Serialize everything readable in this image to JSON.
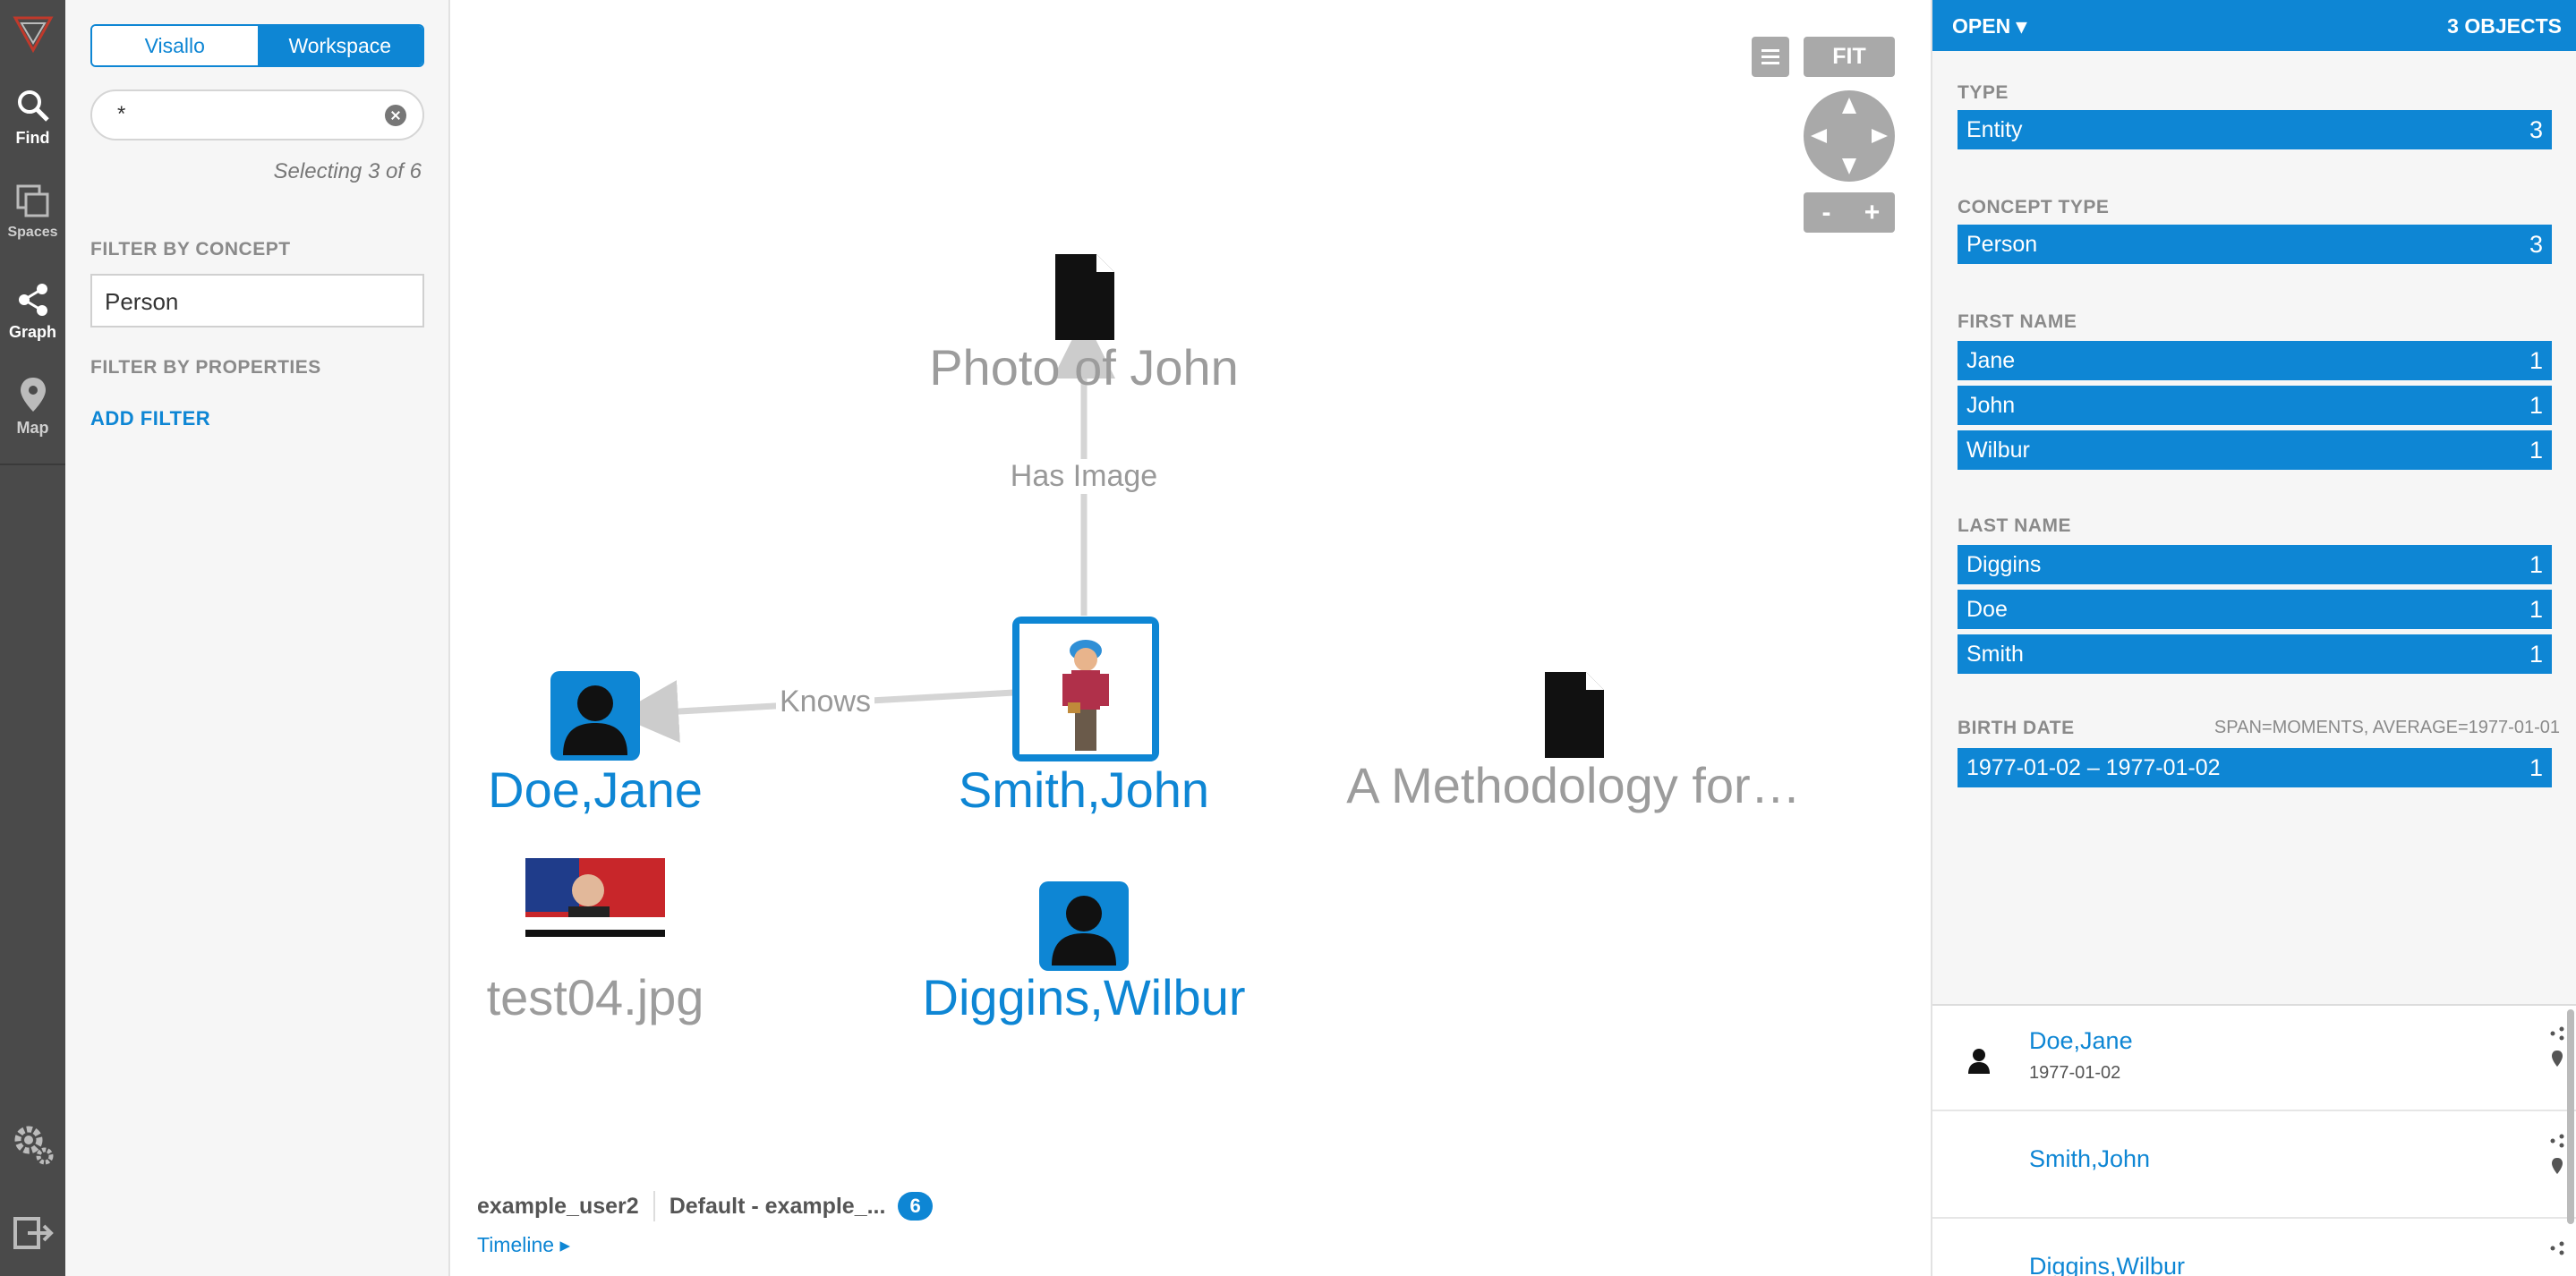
{
  "app": {
    "nav": [
      {
        "label": "Find",
        "icon": "search-icon"
      },
      {
        "label": "Spaces",
        "icon": "spaces-icon"
      },
      {
        "label": "Graph",
        "icon": "share-graph-icon"
      },
      {
        "label": "Map",
        "icon": "map-pin-icon"
      }
    ],
    "nav_bottom": [
      "settings-icon",
      "logout-icon"
    ]
  },
  "search": {
    "tabs": [
      "Visallo",
      "Workspace"
    ],
    "active_tab": "Workspace",
    "query": "*",
    "selecting": "Selecting 3 of 6",
    "filter_concept_title": "FILTER BY CONCEPT",
    "concept_value": "Person",
    "filter_props_title": "FILTER BY PROPERTIES",
    "add_filter": "ADD FILTER"
  },
  "graph": {
    "nodes": {
      "photo": "Photo of John",
      "doe": "Doe,Jane",
      "smith": "Smith,John",
      "methodology": "A Methodology for…",
      "test04": "test04.jpg",
      "diggins": "Diggins,Wilbur"
    },
    "edges": {
      "has_image": "Has Image",
      "knows": "Knows"
    },
    "controls": {
      "fit": "FIT",
      "zoom_out": "-",
      "zoom_in": "+"
    },
    "footer": {
      "user": "example_user2",
      "workspace": "Default - example_...",
      "count": "6",
      "timeline": "Timeline ▸"
    }
  },
  "details": {
    "open_label": "OPEN ▾",
    "count_label": "3 OBJECTS",
    "histograms": {
      "type": {
        "title": "TYPE",
        "bars": [
          {
            "value": "Entity",
            "count": "3"
          }
        ]
      },
      "concept": {
        "title": "CONCEPT TYPE",
        "bars": [
          {
            "value": "Person",
            "count": "3"
          }
        ]
      },
      "first": {
        "title": "FIRST NAME",
        "bars": [
          {
            "value": "Jane",
            "count": "1"
          },
          {
            "value": "John",
            "count": "1"
          },
          {
            "value": "Wilbur",
            "count": "1"
          }
        ]
      },
      "last": {
        "title": "LAST NAME",
        "bars": [
          {
            "value": "Diggins",
            "count": "1"
          },
          {
            "value": "Doe",
            "count": "1"
          },
          {
            "value": "Smith",
            "count": "1"
          }
        ]
      },
      "birth": {
        "title": "BIRTH DATE",
        "note": "SPAN=MOMENTS, AVERAGE=1977-01-01",
        "bars": [
          {
            "value": "1977-01-02 – 1977-01-02",
            "count": "1"
          }
        ]
      }
    },
    "results": [
      {
        "title": "Doe,Jane",
        "sub": "1977-01-02"
      },
      {
        "title": "Smith,John",
        "sub": ""
      },
      {
        "title": "Diggins,Wilbur",
        "sub": ""
      }
    ]
  },
  "colors": {
    "accent": "#0e86d4",
    "nav_bg": "#4a4a4a",
    "panel_bg": "#f6f6f6"
  }
}
